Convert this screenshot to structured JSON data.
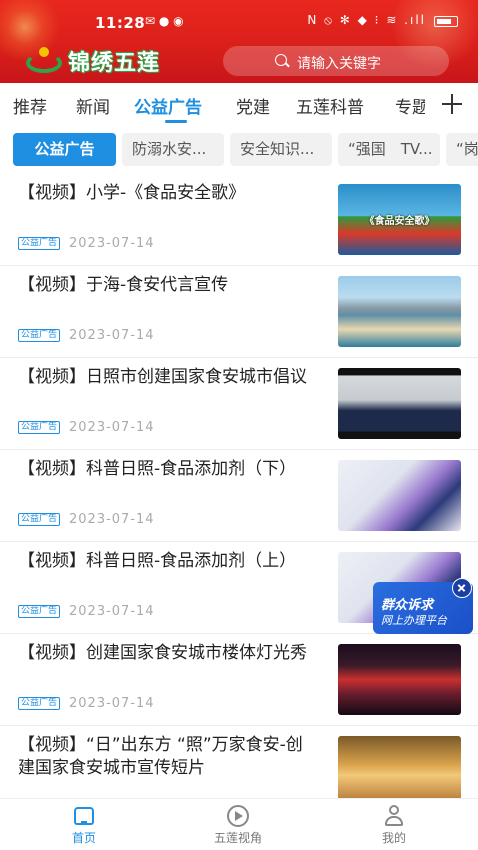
{
  "status_bar": {
    "time": "11:28",
    "left_icons": "✉ ● ◉",
    "right_icons": "N ⦸ ✻ ◆ ⁝ ≋ .ıll"
  },
  "header": {
    "logo_text": "锦绣五莲",
    "search_placeholder": "请输入关键字"
  },
  "tabs": {
    "items": [
      {
        "label": "推荐"
      },
      {
        "label": "新闻"
      },
      {
        "label": "公益广告"
      },
      {
        "label": "党建"
      },
      {
        "label": "五莲科普"
      },
      {
        "label": "专题"
      }
    ],
    "active": "公益广告"
  },
  "subtabs": {
    "items": [
      {
        "label": "公益广告"
      },
      {
        "label": "防溺水安..."
      },
      {
        "label": "安全知识..."
      },
      {
        "label": "“强国　TV..."
      },
      {
        "label": "“岗"
      }
    ]
  },
  "list": {
    "badge_label": "公益广告",
    "items": [
      {
        "title": "【视频】小学-《食品安全歌》",
        "date": "2023-07-14",
        "thumb_caption": "《食品安全歌》"
      },
      {
        "title": "【视频】于海-食安代言宣传",
        "date": "2023-07-14",
        "thumb_caption": ""
      },
      {
        "title": "【视频】日照市创建国家食安城市倡议",
        "date": "2023-07-14",
        "thumb_caption": ""
      },
      {
        "title": "【视频】科普日照-食品添加剂（下）",
        "date": "2023-07-14",
        "thumb_caption": ""
      },
      {
        "title": "【视频】科普日照-食品添加剂（上）",
        "date": "2023-07-14",
        "thumb_caption": ""
      },
      {
        "title": "【视频】创建国家食安城市楼体灯光秀",
        "date": "2023-07-14",
        "thumb_caption": ""
      },
      {
        "title": "【视频】“日”出东方 “照”万家食安-创建国家食安城市宣传短片",
        "date": "",
        "thumb_caption": ""
      }
    ]
  },
  "float_banner": {
    "line1": "群众诉求",
    "line2": "网上办理平台"
  },
  "bottom_nav": {
    "items": [
      {
        "label": "首页",
        "icon": "home-icon"
      },
      {
        "label": "五莲视角",
        "icon": "play-icon"
      },
      {
        "label": "我的",
        "icon": "user-icon"
      }
    ],
    "active": "首页"
  },
  "colors": {
    "header_red": "#d91e1a",
    "accent_blue": "#1e8fe1"
  }
}
